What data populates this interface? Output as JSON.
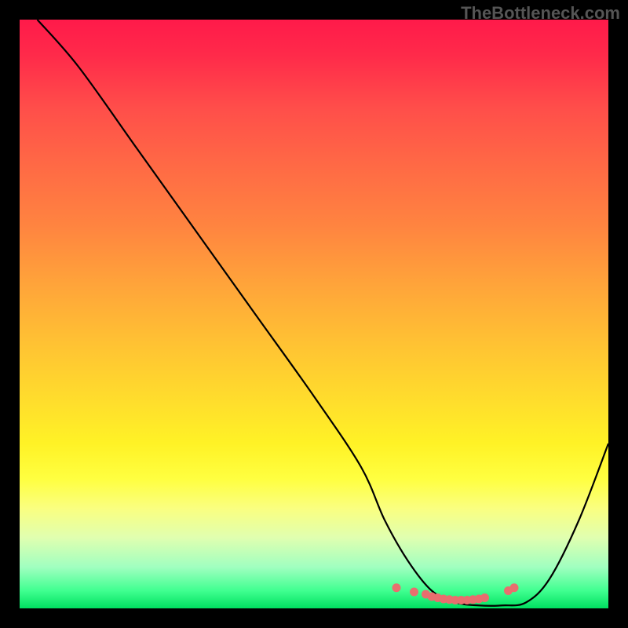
{
  "watermark": "TheBottleneck.com",
  "chart_data": {
    "type": "line",
    "title": "",
    "xlabel": "",
    "ylabel": "",
    "xlim": [
      0,
      100
    ],
    "ylim": [
      0,
      100
    ],
    "series": [
      {
        "name": "bottleneck-curve",
        "x": [
          3,
          10,
          20,
          30,
          40,
          50,
          58,
          62,
          66,
          70,
          74,
          78,
          82,
          86,
          90,
          95,
          100
        ],
        "y": [
          100,
          92,
          78,
          64,
          50,
          36,
          24,
          15,
          8,
          3,
          1,
          0.5,
          0.5,
          1,
          5,
          15,
          28
        ],
        "stroke": "#000000"
      }
    ],
    "markers": {
      "name": "valley-dots",
      "color": "#e86e6e",
      "x": [
        64,
        67,
        69,
        70,
        71,
        72,
        73,
        74,
        75,
        76,
        77,
        78,
        79,
        83,
        84
      ],
      "y": [
        3.5,
        2.8,
        2.4,
        2.0,
        1.8,
        1.6,
        1.5,
        1.4,
        1.4,
        1.4,
        1.5,
        1.6,
        1.8,
        3.0,
        3.5
      ]
    },
    "gradient_stops": [
      {
        "pos": 0,
        "color": "#ff1a4a"
      },
      {
        "pos": 50,
        "color": "#ffb030"
      },
      {
        "pos": 80,
        "color": "#ffff40"
      },
      {
        "pos": 100,
        "color": "#00e060"
      }
    ]
  }
}
